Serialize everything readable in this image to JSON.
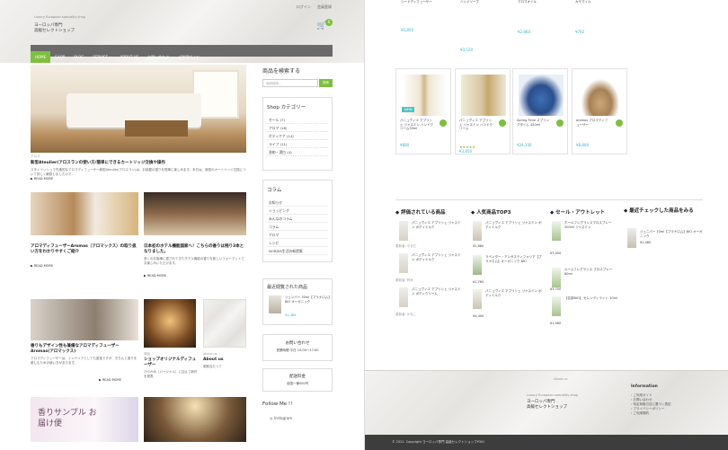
{
  "header": {
    "tagline": "Luxury European speciality shop",
    "logo_line1": "ヨーロッパ専門",
    "logo_line2": "高級セレクトショップ",
    "logo_word": "YOKI",
    "login": "ログイン",
    "register": "会員登録",
    "cart_count": "0"
  },
  "nav": [
    "HOME",
    "SHOP",
    "BLOG",
    "SERVICE ▾",
    "ABOUT US",
    "お問い合わせ",
    "ご利用ガイド"
  ],
  "hero_post": {
    "meta": "アロマ",
    "title": "新型Ateulier(アロスランの使い方/簡単にできるカートリッジ交換や操作",
    "text": "スタイリッシュで先進的なアロマディフューザー新型Ateulier(アロスラン)は、お部屋の香りを簡単に楽しめます。本日は、新型のカートリッジ交換について詳しく解説しましたので...",
    "more": "READ MORE"
  },
  "posts": [
    {
      "title": "アロマディフューザーAromas（アロマックス）の取り扱い方をわかりやすくご紹介",
      "more": "READ MORE"
    },
    {
      "title": "日本初のホテル機能国家へ！こちらの香りは残り3本となりました。",
      "text": "多くのお客様に愛されてきたホテル機能の香りを新しいフォーマットでお楽しみいただけます。",
      "more": "READ MORE"
    }
  ],
  "bottom_posts": [
    {
      "title": "香りもデザイン性も兼備なアロマディフューザーAromas(アロマックス)",
      "text": "アロマディフューザーは、インテリアとしても重宝ですが、きちんと香りを楽しむための使い方があります。",
      "more": "READ MORE"
    },
    {
      "title": "ショップオリジナルディフューザー",
      "text": "ひやかみ（パーソナル）に加えて新作を発表",
      "label": "商品"
    },
    {
      "title": "About us",
      "text": "昭和当たって",
      "label": "About us"
    }
  ],
  "banner_text": "香りサンプル お届け便",
  "sidebar": {
    "search_title": "商品を検索する",
    "search_placeholder": "商品検索…",
    "search_btn": "検索",
    "shop_cat_title": "Shop カテゴリー",
    "shop_cats": [
      "セール (7)",
      "アロマ (16)",
      "ボディケア (14)",
      "ライフ (11)",
      "洗剤・漂白 (4)"
    ],
    "column_title": "コラム",
    "columns": [
      "お知らせ",
      "ショッピング",
      "みんなのコラム",
      "コラム",
      "アロマ",
      "レシピ",
      "NORDIS生活の新提案"
    ],
    "recent_title": "最近閲覧された商品",
    "recent_item": "ジュンバー 30ml【ブラナロム】BIO オーガニック",
    "recent_price": "¥1,480",
    "contact_title": "お問い合わせ",
    "contact_hours": "営業時間 平日 10:00〜17:00",
    "shipping_title": "配送料金",
    "shipping_text": "全国一律500円",
    "follow": "Follow Me !!",
    "instagram": "Instagram"
  },
  "right_top_products": [
    {
      "name": "リードディフューザー",
      "price": "¥3,850"
    },
    {
      "name": "ハンドソープ",
      "price": "¥3,120"
    },
    {
      "name": "アロマオイル",
      "price": "¥2,860"
    },
    {
      "name": "カモマイル",
      "price": "¥792"
    }
  ],
  "right_products": [
    {
      "name": "パニュヴィエ アプリシェ ジャスミン ハンドクリーム30ml",
      "price": "¥880",
      "tag": "NEW"
    },
    {
      "name": "パニュヴィエ アプリシェ ジャスミン ハンドクリーム",
      "price": "¥3,850",
      "tag": ""
    },
    {
      "name": "Spring Time スプリングタイム 450ml",
      "price": "¥24,330",
      "tag": ""
    },
    {
      "name": "aromax アロマディフューザー",
      "price": "¥8,800",
      "tag": ""
    }
  ],
  "sections": {
    "rated": "評価されている商品",
    "top3": "人気商品TOP3",
    "sale": "セール・アウトレット",
    "recent": "最近チェックした商品をみる"
  },
  "rated_items": [
    {
      "name": "パニュヴィエ アプリシェ ジャスミン ボディミルク",
      "reviewer": "更新者: やまだ"
    },
    {
      "name": "パニュヴィエ アプリシェ ジャスミン ボディミルク",
      "reviewer": "更新者: 鈴木"
    },
    {
      "name": "パニュヴィエ アプリシェ ジャスミン ボディクリーム",
      "reviewer": "更新者: かなこ"
    }
  ],
  "top3_items": [
    {
      "name": "パニュヴィエ アプリシェ ジャスミン ボディミルク",
      "price": "¥2,860"
    },
    {
      "name": "ラベンダー・アンガスティフォリア【プラナロム】オーガニック BIO",
      "price": "¥1,760"
    },
    {
      "name": "パニュヴィエ アプリシェ ジャスミン ボディミルク",
      "price": "¥4,400"
    }
  ],
  "sale_items": [
    {
      "name": "ホールフレグランスプロスプレー 300ml ジャスミン",
      "price": "¥3,450"
    },
    {
      "name": "ルームフレグランス プロスプレー 80ml",
      "price": "¥3,750"
    },
    {
      "name": "【名前BIO】 セレンディライト 10ml",
      "price": "¥1,960"
    }
  ],
  "recent_checked": {
    "name": "ジュニパー 10ml【プラナロム】BIO オーガニック",
    "price": "¥1,480"
  },
  "footer": {
    "tagline": "Luxury European speciality shop",
    "logo_line1": "ヨーロッパ専門",
    "logo_line2": "高級セレクトショップ",
    "logo_word": "YOKI",
    "about": "About us",
    "info_title": "Information",
    "info_links": [
      "ご利用ガイド",
      "お問い合わせ",
      "特定商取引法に基づく表記",
      "プライバシーポリシー",
      "ご利用規約"
    ],
    "copyright": "© 2021. Copyright ヨーロッパ専門 高級セレクトショップYOKI"
  }
}
